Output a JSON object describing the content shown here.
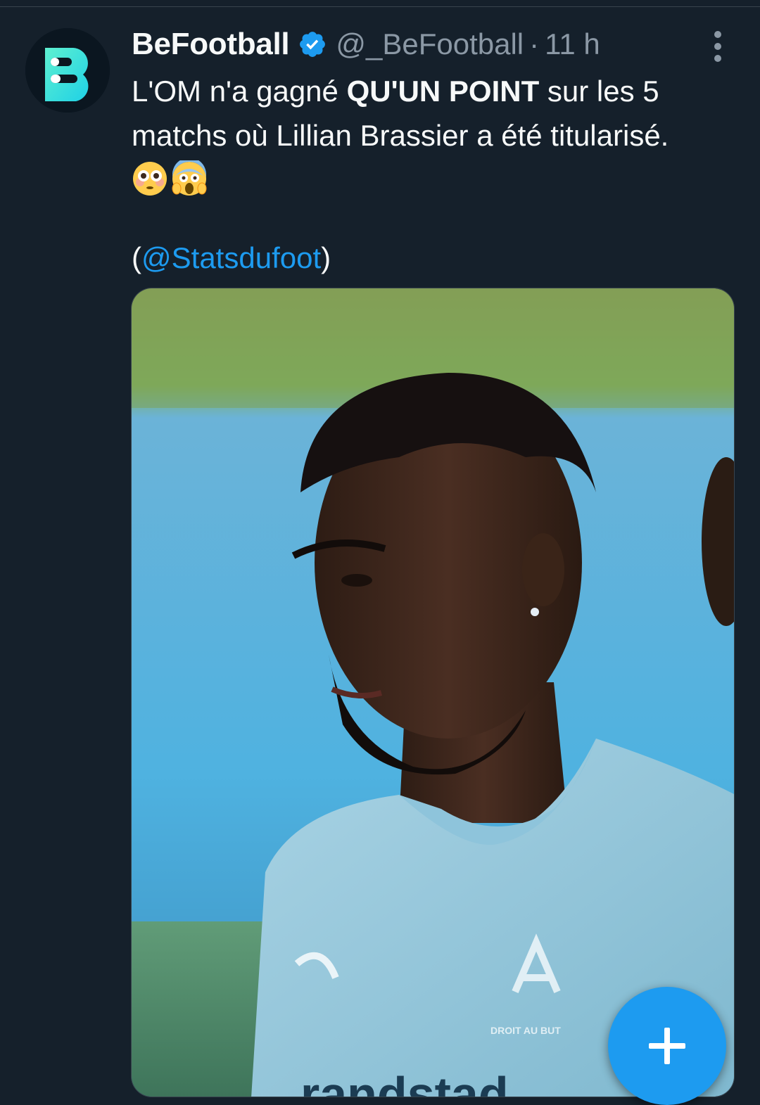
{
  "tweet": {
    "author": {
      "display_name": "BeFootball",
      "handle": "@_BeFootball",
      "verified": true,
      "avatar_icon": "befootball-logo-icon"
    },
    "separator": "·",
    "time": "11 h",
    "text": {
      "part1": "L'OM n'a gagné ",
      "bold": "QU'UN POINT",
      "part2": " sur les 5 matchs où Lillian Brassier a été titularisé.",
      "emojis": [
        "flushed-face-icon",
        "screaming-face-icon"
      ]
    },
    "credit": {
      "open": "(",
      "mention": "@Statsdufoot",
      "close": ")"
    },
    "media": {
      "description_icon": "player-photo",
      "jersey_text": "DROIT AU BUT",
      "sponsor_text": "randstad"
    }
  },
  "fab": {
    "icon": "plus-icon"
  },
  "colors": {
    "background": "#15202b",
    "text": "#f7f9f9",
    "muted": "#8b98a5",
    "accent": "#1d9bf0"
  }
}
